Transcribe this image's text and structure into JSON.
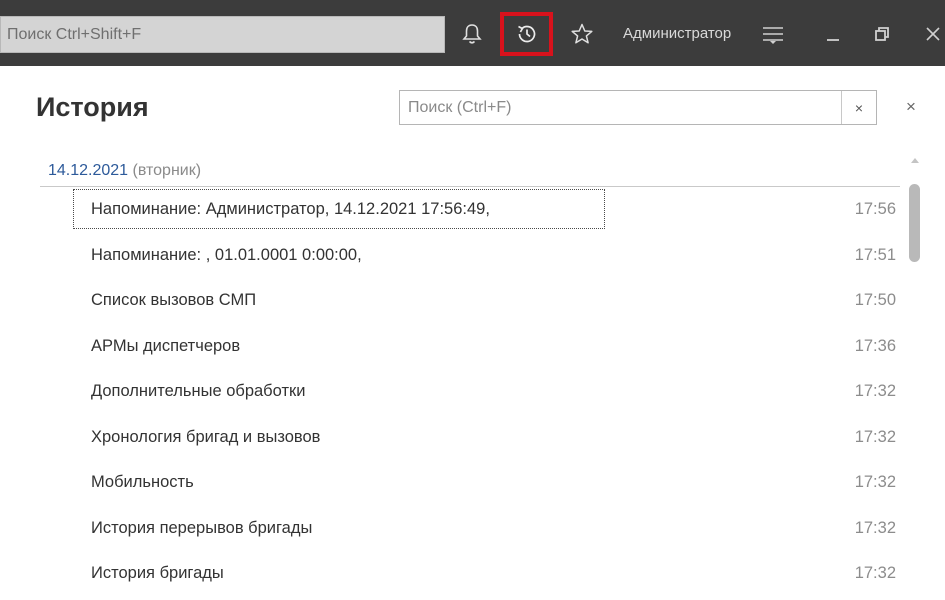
{
  "toolbar": {
    "search_text": "Поиск Ctrl+Shift+F",
    "user_name": "Администратор",
    "highlight_color": "#d8121c",
    "icons": [
      "bell-icon",
      "history-icon",
      "star-icon",
      "menu-icon",
      "minimize-icon",
      "restore-icon",
      "close-icon"
    ]
  },
  "panel": {
    "title": "История",
    "search_placeholder": "Поиск (Ctrl+F)",
    "clear_label": "×",
    "close_label": "×",
    "date": "14.12.2021",
    "weekday": "(вторник)",
    "items": [
      {
        "title": "Напоминание: Администратор, 14.12.2021 17:56:49,",
        "time": "17:56"
      },
      {
        "title": "Напоминание: , 01.01.0001 0:00:00,",
        "time": "17:51"
      },
      {
        "title": "Список вызовов СМП",
        "time": "17:50"
      },
      {
        "title": "АРМы диспетчеров",
        "time": "17:36"
      },
      {
        "title": "Дополнительные обработки",
        "time": "17:32"
      },
      {
        "title": "Хронология бригад и вызовов",
        "time": "17:32"
      },
      {
        "title": "Мобильность",
        "time": "17:32"
      },
      {
        "title": "История перерывов бригады",
        "time": "17:32"
      },
      {
        "title": "История бригады",
        "time": "17:32"
      }
    ]
  }
}
